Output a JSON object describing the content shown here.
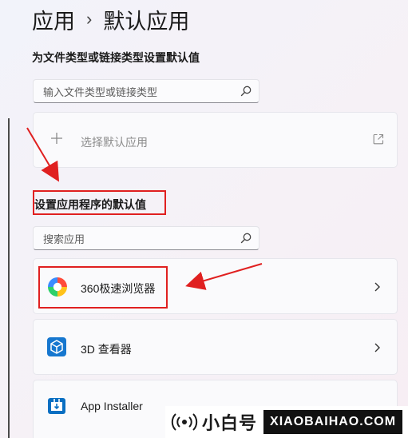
{
  "breadcrumb": {
    "parent": "应用",
    "separator": "›",
    "current": "默认应用"
  },
  "file_types_section": {
    "heading": "为文件类型或链接类型设置默认值",
    "search_placeholder": "输入文件类型或链接类型",
    "choose_default_label": "选择默认应用"
  },
  "apps_section": {
    "heading": "设置应用程序的默认值",
    "search_placeholder": "搜索应用",
    "apps": [
      {
        "name": "360极速浏览器",
        "icon": "360-browser-icon"
      },
      {
        "name": "3D 查看器",
        "icon": "3d-viewer-icon"
      },
      {
        "name": "App Installer",
        "icon": "app-installer-icon"
      }
    ]
  },
  "watermark": {
    "name": "小白号",
    "domain": "XIAOBAIHAO.COM"
  },
  "colors": {
    "annotation_red": "#e02020",
    "accent_blue": "#0a6fc2"
  }
}
